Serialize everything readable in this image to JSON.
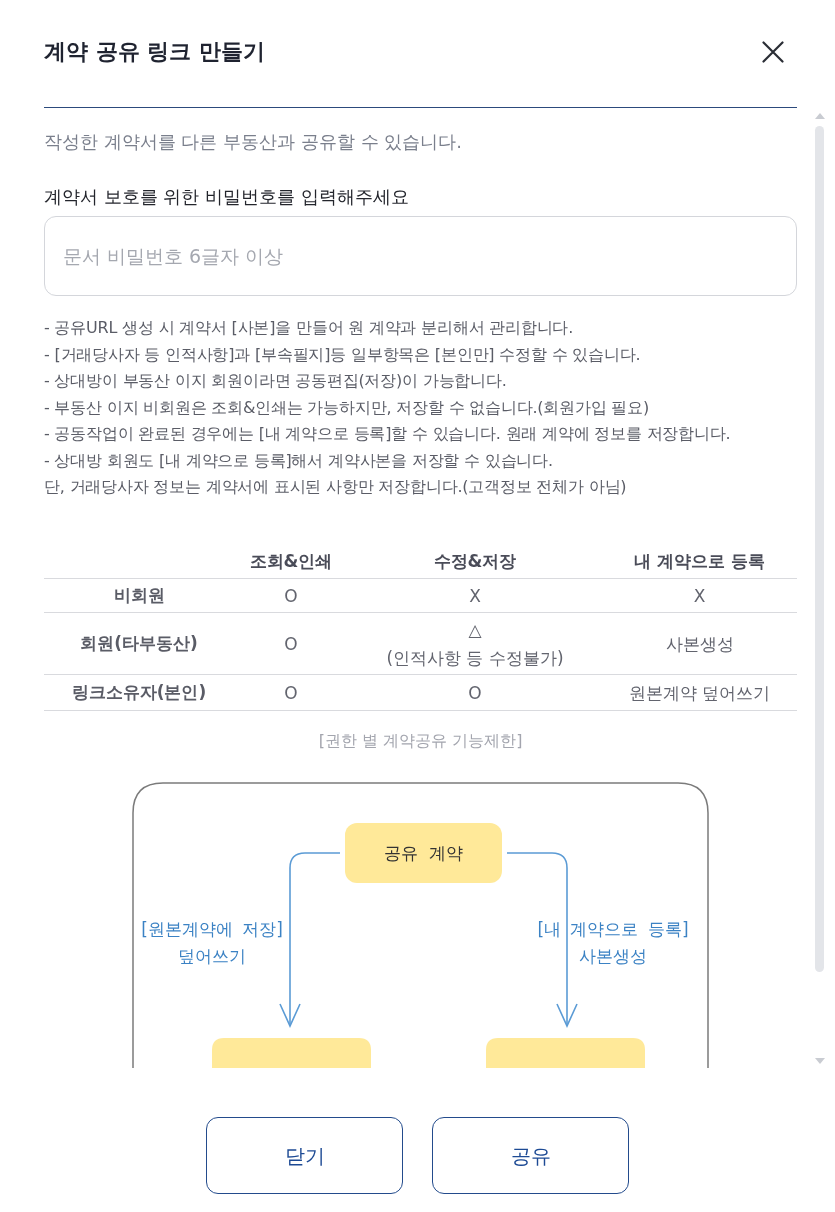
{
  "dialog": {
    "title": "계약 공유 링크 만들기"
  },
  "intro": "작성한 계약서를 다른 부동산과 공유할 수 있습니다.",
  "password": {
    "label": "계약서 보호를 위한 비밀번호를 입력해주세요",
    "placeholder": "문서 비밀번호 6글자 이상"
  },
  "notes": [
    "- 공유URL 생성 시 계약서 [사본]을 만들어 원 계약과 분리해서 관리합니다.",
    "- [거래당사자 등 인적사항]과 [부속필지]등 일부항목은 [본인만] 수정할 수 있습니다.",
    "- 상대방이 부동산 이지 회원이라면 공동편집(저장)이 가능합니다.",
    "- 부동산 이지 비회원은 조회&인쇄는 가능하지만, 저장할 수 없습니다.(회원가입 필요)",
    "- 공동작업이 완료된 경우에는 [내 계약으로 등록]할 수 있습니다. 원래 계약에 정보를 저장합니다.",
    "- 상대방 회원도 [내 계약으로 등록]해서 계약사본을 저장할 수 있습니다.",
    "단, 거래당사자 정보는 계약서에 표시된 사항만 저장합니다.(고객정보 전체가 아님)"
  ],
  "permission_table": {
    "columns": [
      "조회&인쇄",
      "수정&저장",
      "내 계약으로 등록"
    ],
    "rows": [
      {
        "role": "비회원",
        "cells": [
          [
            "O"
          ],
          [
            "X"
          ],
          [
            "X"
          ]
        ]
      },
      {
        "role": "회원(타부동산)",
        "cells": [
          [
            "O"
          ],
          [
            "△",
            "(인적사항 등 수정불가)"
          ],
          [
            "사본생성"
          ]
        ]
      },
      {
        "role": "링크소유자(본인)",
        "cells": [
          [
            "O"
          ],
          [
            "O"
          ],
          [
            "원본계약 덮어쓰기"
          ]
        ]
      }
    ],
    "caption": "[권한 별 계약공유 기능제한]"
  },
  "diagram": {
    "top_node": "공유 계약",
    "branches": [
      {
        "label": [
          "[원본계약에 저장]",
          "덮어쓰기"
        ]
      },
      {
        "label": [
          "[내 계약으로 등록]",
          "사본생성"
        ]
      }
    ]
  },
  "buttons": [
    "닫기",
    "공유"
  ]
}
